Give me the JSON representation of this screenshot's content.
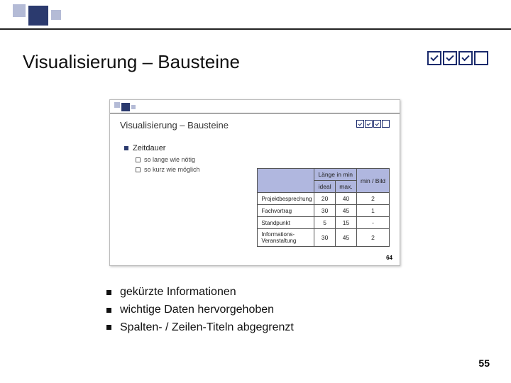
{
  "title": "Visualisierung – Bausteine",
  "progress_checked": [
    true,
    true,
    true,
    false
  ],
  "inset": {
    "title": "Visualisierung – Bausteine",
    "progress_checked": [
      true,
      true,
      true,
      false
    ],
    "section_heading": "Zeitdauer",
    "items": [
      "so lange wie nötig",
      "so kurz wie möglich"
    ],
    "table": {
      "col_group_1": "Länge in min",
      "col_group_2": "min / Bild",
      "sub1": "ideal",
      "sub2": "max.",
      "rows": [
        {
          "label": "Projektbesprechung",
          "ideal": "20",
          "max": "40",
          "minbild": "2"
        },
        {
          "label": "Fachvortrag",
          "ideal": "30",
          "max": "45",
          "minbild": "1"
        },
        {
          "label": "Standpunkt",
          "ideal": "5",
          "max": "15",
          "minbild": "-"
        },
        {
          "label": "Informations-Veranstaltung",
          "ideal": "30",
          "max": "45",
          "minbild": "2"
        }
      ]
    },
    "page": "64"
  },
  "bullets": [
    "gekürzte Informationen",
    "wichtige Daten hervorgehoben",
    "Spalten- / Zeilen-Titeln abgegrenzt"
  ],
  "page": "55",
  "colors": {
    "accent": "#2b3a6e",
    "light": "#b4bbd6",
    "table_hdr": "#b0b7df"
  }
}
